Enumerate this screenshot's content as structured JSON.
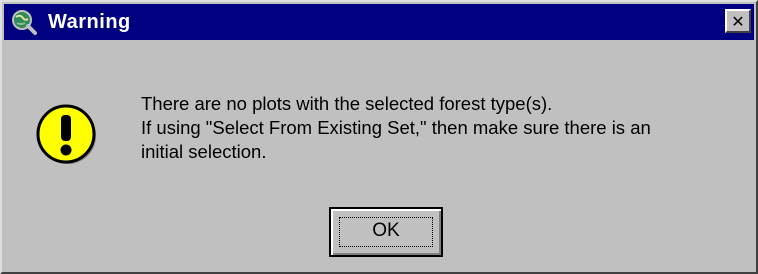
{
  "window": {
    "title": "Warning",
    "title_icon": "globe-magnifier-icon",
    "close_glyph": "✕",
    "titlebar_color": "#000080",
    "background_color": "#c0c0c0"
  },
  "message": {
    "icon": "exclamation-warning-icon",
    "icon_color": "#ffff00",
    "lines": [
      "There are no plots with the selected forest type(s).",
      "If using \"Select From Existing Set,\" then make sure there is an",
      "initial selection."
    ]
  },
  "buttons": {
    "ok_label": "OK"
  }
}
